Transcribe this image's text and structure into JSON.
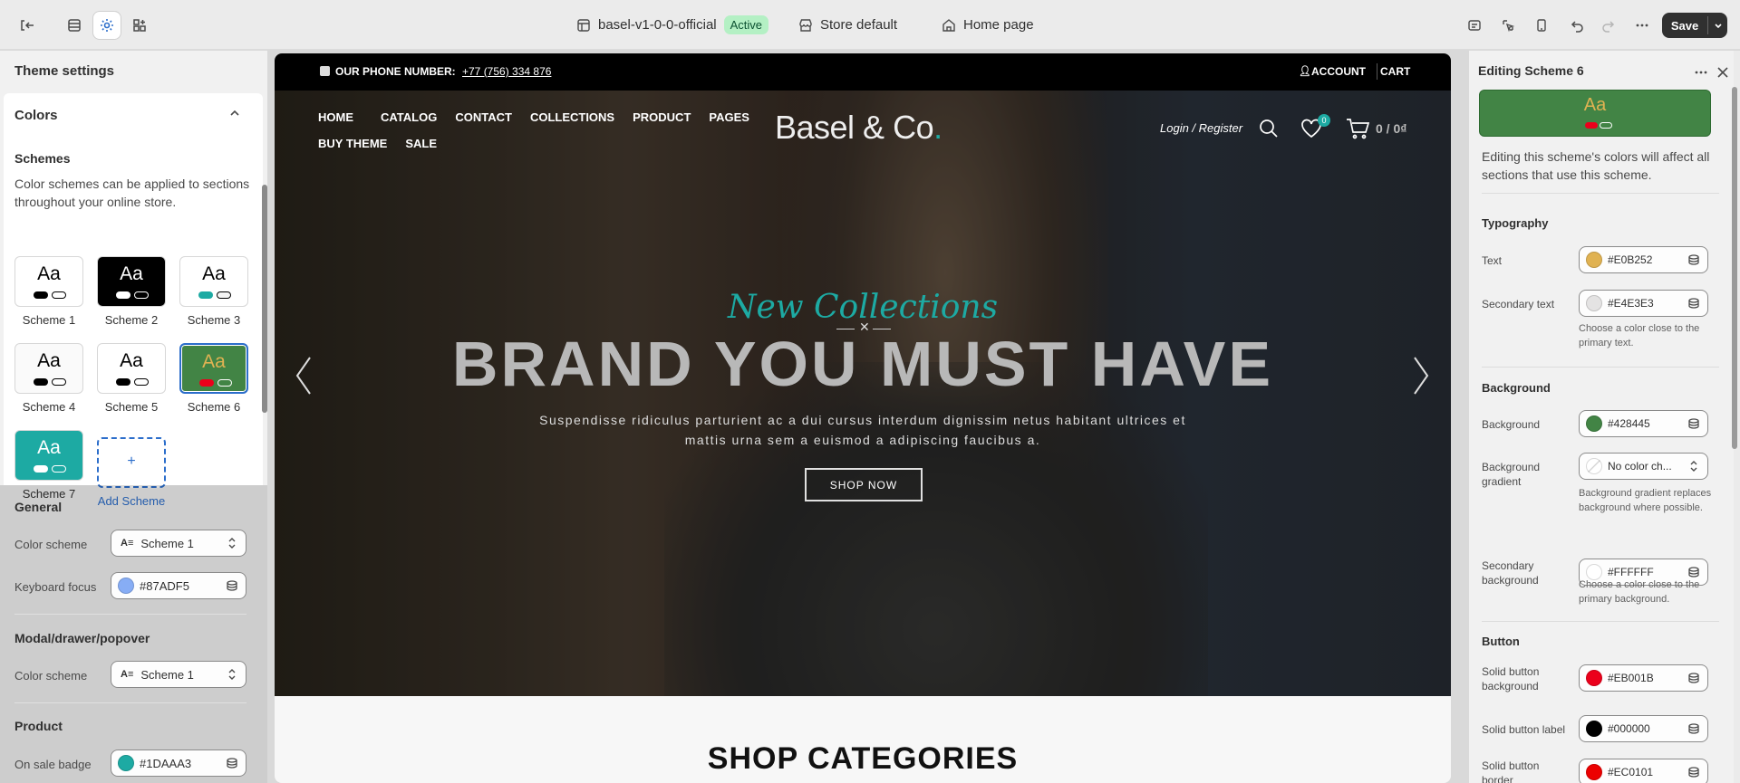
{
  "topbar": {
    "theme_name": "basel-v1-0-0-official",
    "status": "Active",
    "store": "Store default",
    "page": "Home page",
    "save_label": "Save"
  },
  "left": {
    "title": "Theme settings",
    "colors_title": "Colors",
    "schemes_heading": "Schemes",
    "schemes_desc": "Color schemes can be applied to sections throughout your online store.",
    "schemes": [
      {
        "name": "Scheme 1",
        "bg": "#ffffff",
        "fg": "#000000",
        "p1": "#000000",
        "p2": "#ffffff"
      },
      {
        "name": "Scheme 2",
        "bg": "#000000",
        "fg": "#ffffff",
        "p1": "#ffffff",
        "p2": "#000000"
      },
      {
        "name": "Scheme 3",
        "bg": "#ffffff",
        "fg": "#000000",
        "p1": "#1daaa3",
        "p2": "#f4f4f4"
      },
      {
        "name": "Scheme 4",
        "bg": "#fafafa",
        "fg": "#000000",
        "p1": "#000000",
        "p2": "#ffffff"
      },
      {
        "name": "Scheme 5",
        "bg": "#ffffff",
        "fg": "#000000",
        "p1": "#000000",
        "p2": "#ffffff"
      },
      {
        "name": "Scheme 6",
        "bg": "#428445",
        "fg": "#e0b252",
        "p1": "#eb001b",
        "p2": "#428445"
      },
      {
        "name": "Scheme 7",
        "bg": "#1daaa3",
        "fg": "#ffffff",
        "p1": "#ffffff",
        "p2": "#1daaa3"
      }
    ],
    "add_scheme": "Add Scheme",
    "add_plus": "+",
    "general": {
      "heading": "General",
      "color_scheme_label": "Color scheme",
      "color_scheme_value": "Scheme 1",
      "keyboard_focus_label": "Keyboard focus",
      "keyboard_focus_value": "#87ADF5",
      "keyboard_focus_color": "#87adf5"
    },
    "modal": {
      "heading": "Modal/drawer/popover",
      "color_scheme_label": "Color scheme",
      "color_scheme_value": "Scheme 1"
    },
    "product": {
      "heading": "Product",
      "on_sale_label": "On sale badge",
      "on_sale_value": "#1DAAA3",
      "on_sale_color": "#1daaa3"
    }
  },
  "preview": {
    "phone_label": "OUR PHONE NUMBER:",
    "phone": "+77 (756) 334 876",
    "account": "ACCOUNT",
    "cart": "CART",
    "nav": [
      "HOME",
      "CATALOG",
      "CONTACT",
      "COLLECTIONS",
      "PRODUCT",
      "PAGES"
    ],
    "nav2": [
      "BUY THEME",
      "SALE"
    ],
    "brand": "Basel & Co",
    "brand_dot": ".",
    "login": "Login / Register",
    "wishlist_count": "0",
    "cart_total": "0 / 0₫",
    "script_title": "New Collections",
    "headline": "BRAND YOU MUST HAVE",
    "subtitle": "Suspendisse ridiculus parturient ac a dui cursus interdum dignissim netus habitant ultrices et mattis urna sem a euismod a adipiscing faucibus a.",
    "cta": "SHOP NOW",
    "section_heading": "SHOP CATEGORIES"
  },
  "right": {
    "title": "Editing Scheme 6",
    "preview_aa": "Aa",
    "note": "Editing this scheme's colors will affect all sections that use this scheme.",
    "typography": "Typography",
    "text_label": "Text",
    "text_value": "#E0B252",
    "secondary_text_label": "Secondary text",
    "secondary_text_value": "#E4E3E3",
    "secondary_text_help": "Choose a color close to the primary text.",
    "background_heading": "Background",
    "background_label": "Background",
    "background_value": "#428445",
    "bg_gradient_label": "Background gradient",
    "bg_gradient_value": "No color ch...",
    "bg_gradient_help": "Background gradient replaces background where possible.",
    "secondary_bg_label": "Secondary background",
    "secondary_bg_value": "#FFFFFF",
    "secondary_bg_help": "Choose a color close to the primary background.",
    "button_heading": "Button",
    "solid_bg_label": "Solid button background",
    "solid_bg_value": "#EB001B",
    "solid_label_label": "Solid button label",
    "solid_label_value": "#000000",
    "solid_border_label": "Solid button border",
    "solid_border_value": "#EC0101",
    "colors": {
      "text": "#e0b252",
      "secondary_text": "#e4e3e3",
      "background": "#428445",
      "secondary_bg": "#ffffff",
      "solid_bg": "#eb001b",
      "solid_label": "#000000",
      "solid_border": "#ec0101"
    }
  }
}
